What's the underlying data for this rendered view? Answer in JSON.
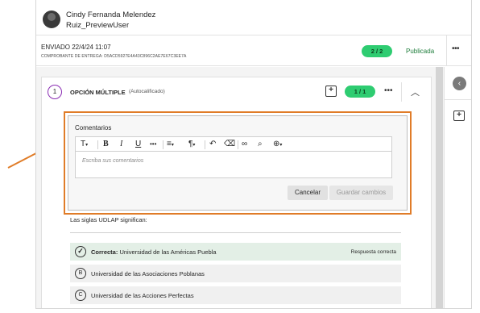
{
  "header": {
    "user_name": "Cindy Fernanda Melendez",
    "user_sub": "Ruiz_PreviewUser"
  },
  "submission": {
    "sent": "ENVIADO 22/4/24 11:07",
    "receipt": "COMPROBANTE DE ENTREGA: D5ACD5927E4A43C896C2AE7E67C3EE7A",
    "score": "2 / 2",
    "status": "Publicada",
    "more": "•••"
  },
  "question": {
    "number": "1",
    "title": "OPCIÓN MÚLTIPLE",
    "subtitle": "(Autocalificado)",
    "score": "1 / 1",
    "more": "•••",
    "prompt": "Las siglas UDLAP significan:"
  },
  "editor": {
    "label": "Comentarios",
    "placeholder": "Escriba sus comentarios",
    "cancel": "Cancelar",
    "save": "Guardar cambios"
  },
  "options": [
    {
      "badge": "✓",
      "prefix": "Correcta:",
      "text": "Universidad de las Américas Puebla",
      "right": "Respuesta correcta"
    },
    {
      "badge": "B",
      "text": "Universidad de las Asociaciones Poblanas"
    },
    {
      "badge": "C",
      "text": "Universidad de las Acciones Perfectas"
    }
  ],
  "colors": {
    "pill_green": "#2ecc71",
    "status_green": "#1e7d3b",
    "highlight_orange": "#e07c28",
    "question_purple": "#8a2db3"
  }
}
